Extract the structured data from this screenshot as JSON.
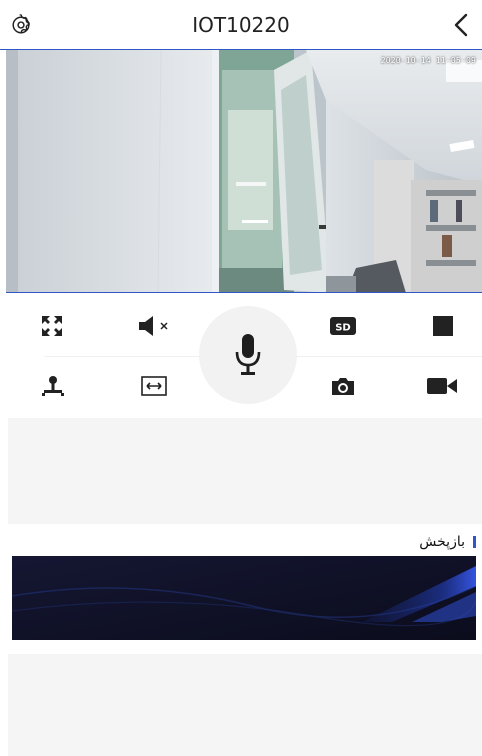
{
  "header": {
    "title": "IOT10220",
    "settings_icon": "gear-icon",
    "back_icon": "chevron-left-icon"
  },
  "video": {
    "timestamp": "2020-10-14 11-05-09"
  },
  "controls": {
    "row1": [
      "fullscreen-icon",
      "mute-icon",
      "sd-icon",
      "stop-icon"
    ],
    "row2": [
      "ptz-icon",
      "fit-width-icon",
      "camera-icon",
      "video-record-icon"
    ],
    "center": "microphone-icon",
    "sd_label": "SD"
  },
  "playback": {
    "label": "بازپخش"
  },
  "colors": {
    "accent": "#2f57c8",
    "icon": "#1e1e1e",
    "panel_bg": "#f5f5f5"
  }
}
